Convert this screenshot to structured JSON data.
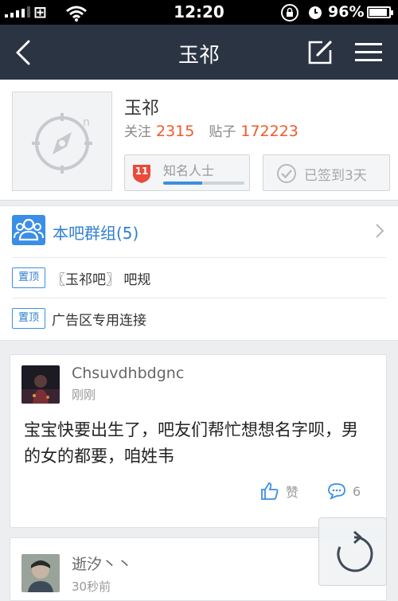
{
  "status_bar": {
    "carrier_icon": "windows-logo-icon",
    "time": "12:20",
    "battery": "96%"
  },
  "nav": {
    "title": "玉祁"
  },
  "forum": {
    "name": "玉祁",
    "follow_label": "关注",
    "follow_count": "2315",
    "posts_label": "贴子",
    "posts_count": "172223",
    "level_number": "11",
    "level_title": "知名人士",
    "level_progress": 0.48,
    "sign_label": "已签到3天"
  },
  "group": {
    "label": "本吧群组(5)"
  },
  "pinned": [
    {
      "tag": "置顶",
      "text": "〖玉祁吧〗 吧规"
    },
    {
      "tag": "置顶",
      "text": "广告区专用连接"
    }
  ],
  "posts": [
    {
      "author": "Chsuvdhbdgnc",
      "time": "刚刚",
      "text": "宝宝快要出生了，吧友们帮忙想想名字呗，男的女的都要，咱姓韦",
      "like_label": "赞",
      "comment_count": "6"
    },
    {
      "author": "逝汐丶丶",
      "time": "30秒前"
    }
  ],
  "colors": {
    "nav_bg": "#2b3443",
    "accent_blue": "#3a8ee6",
    "count_orange": "#f05a28"
  }
}
